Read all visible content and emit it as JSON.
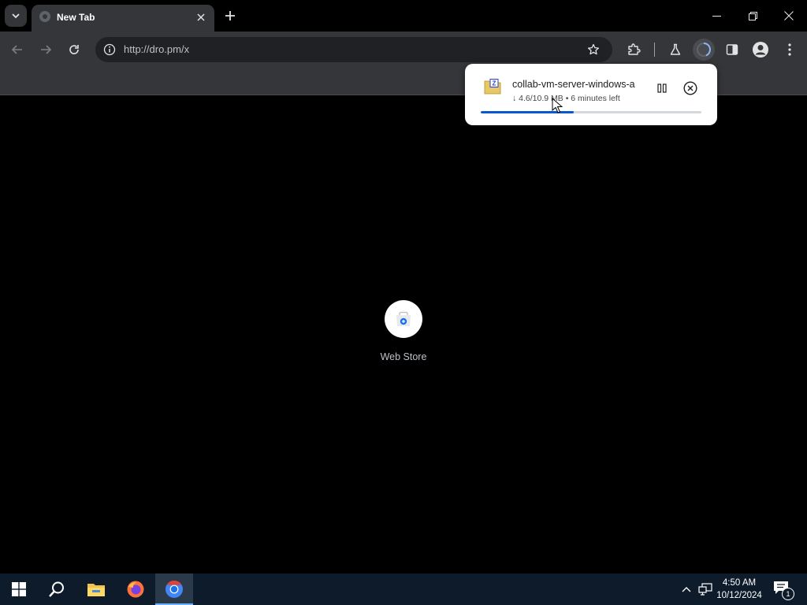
{
  "browser": {
    "tab": {
      "title": "New Tab"
    },
    "address_bar": {
      "url": "http://dro.pm/x"
    }
  },
  "download": {
    "filename": "collab-vm-server-windows-a",
    "status": "↓ 4.6/10.9 MB • 6 minutes left",
    "progress_fraction": 0.42
  },
  "new_tab_page": {
    "shortcuts": [
      {
        "label": "Web Store"
      }
    ]
  },
  "taskbar": {
    "apps": [
      "start",
      "search",
      "file-explorer",
      "firefox",
      "chrome"
    ],
    "clock": {
      "time": "4:50 AM",
      "date": "10/12/2024"
    },
    "notification_count": "1"
  },
  "colors": {
    "tab_active": "#35363a",
    "toolbar": "#35363a",
    "omnibox": "#202124",
    "accent_blue": "#0b57d0",
    "taskbar": "#0d1b2a"
  }
}
